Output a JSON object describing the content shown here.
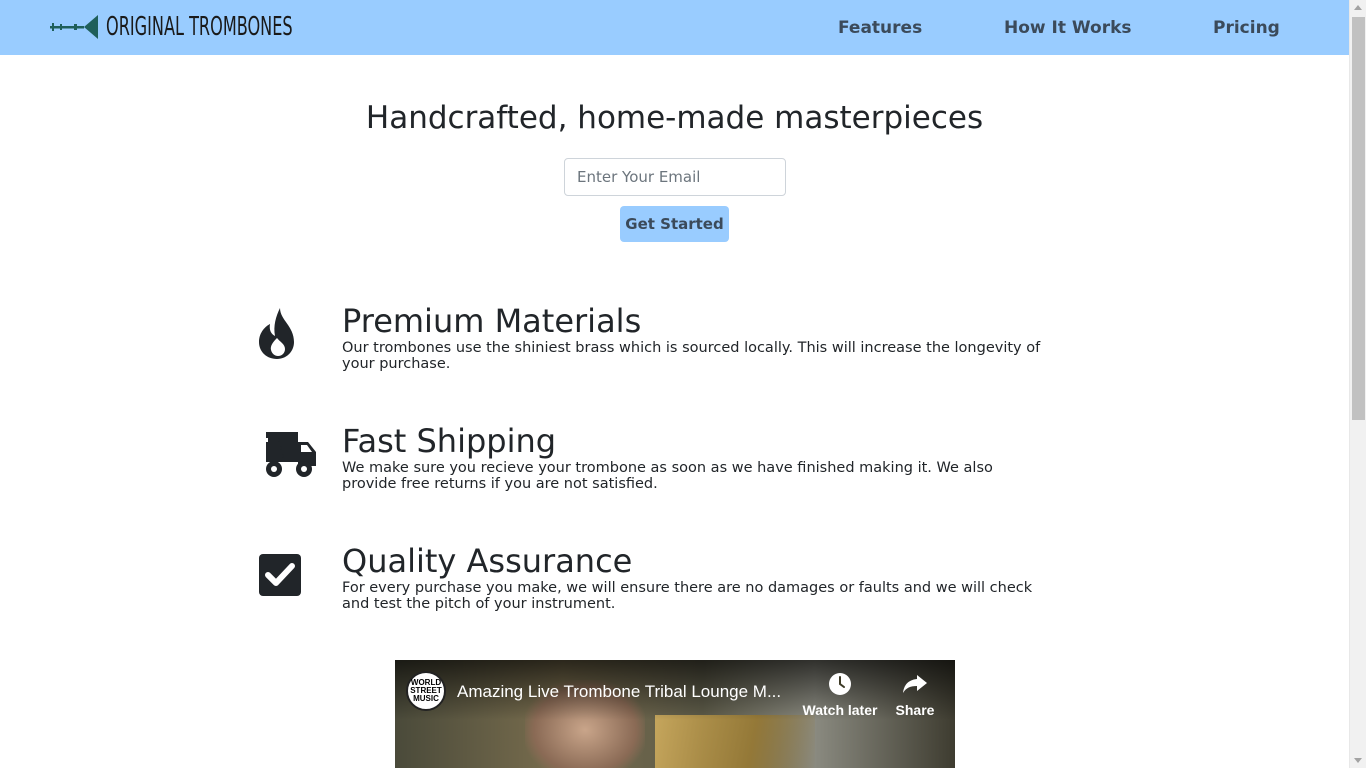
{
  "header": {
    "logo_text": "ORIGINAL  TROMBONES",
    "nav": [
      {
        "label": "Features"
      },
      {
        "label": "How It Works"
      },
      {
        "label": "Pricing"
      }
    ]
  },
  "hero": {
    "title": "Handcrafted, home-made masterpieces",
    "email_placeholder": "Enter Your Email",
    "cta_label": "Get Started"
  },
  "features": [
    {
      "icon": "fire-icon",
      "title": "Premium Materials",
      "description": "Our trombones use the shiniest brass which is sourced locally. This will increase the longevity of your purchase."
    },
    {
      "icon": "shipping-fast-icon",
      "title": "Fast Shipping",
      "description": "We make sure you recieve your trombone as soon as we have finished making it. We also provide free returns if you are not satisfied."
    },
    {
      "icon": "check-square-icon",
      "title": "Quality Assurance",
      "description": "For every purchase you make, we will ensure there are no damages or faults and we will check and test the pitch of your instrument."
    }
  ],
  "video": {
    "channel_logo_text": "WORLD STREET MUSIC",
    "title": "Amazing Live Trombone Tribal Lounge M...",
    "watch_later_label": "Watch later",
    "share_label": "Share"
  },
  "colors": {
    "header_bg": "#99ccff",
    "nav_text": "#3b4a5a",
    "logo_accent": "#1f5f5a"
  }
}
